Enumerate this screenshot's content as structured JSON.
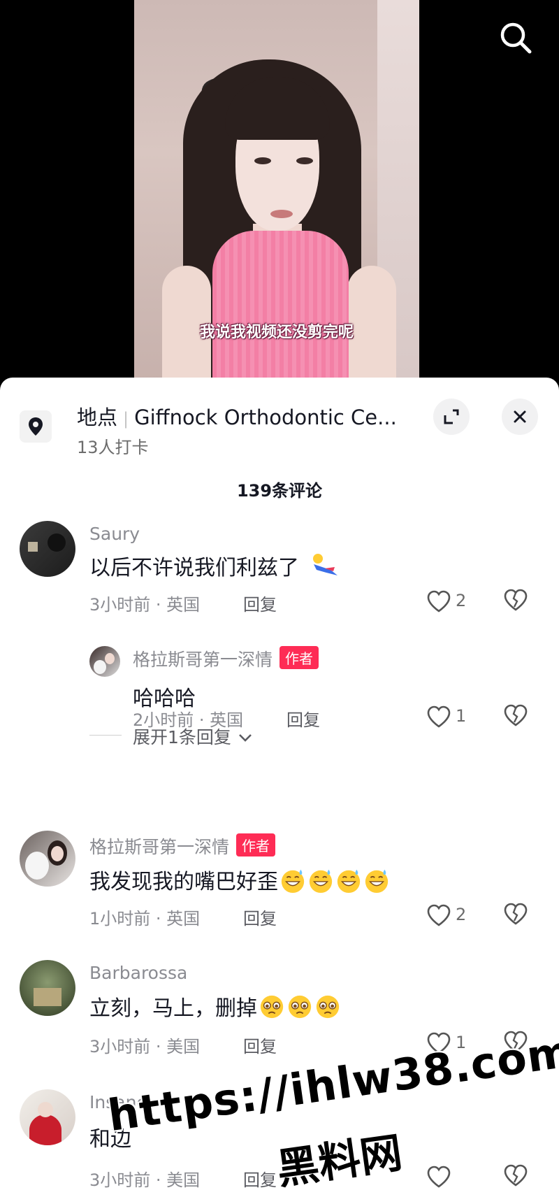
{
  "video": {
    "subtitle": "我说我视频还没剪完呢"
  },
  "location": {
    "label": "地点",
    "name": "Giffnock Orthodontic Ce...",
    "checkins": "13人打卡"
  },
  "comments_header": {
    "count_text": "139条评论"
  },
  "comments": [
    {
      "username": "Saury",
      "text": "以后不许说我们利兹了",
      "time_region": "3小时前 · 英国",
      "reply_label": "回复",
      "likes": "2"
    },
    {
      "username": "格拉斯哥第一深情",
      "badge": "作者",
      "text": "哈哈哈",
      "time_region": "2小时前 · 英国",
      "reply_label": "回复",
      "likes": "1"
    },
    {
      "username": "格拉斯哥第一深情",
      "badge": "作者",
      "text": "我发现我的嘴巴好歪",
      "time_region": "1小时前 · 英国",
      "reply_label": "回复",
      "likes": "2"
    },
    {
      "username": "Barbarossa",
      "text": "立刻，马上，删掉",
      "time_region": "3小时前 · 美国",
      "reply_label": "回复",
      "likes": "1"
    },
    {
      "username": "Insane.",
      "text": "和边",
      "time_region": "3小时前 · 美国",
      "reply_label": "回复",
      "likes": ""
    }
  ],
  "expand_replies": "展开1条回复",
  "watermark": {
    "url": "https://ihlw38.com",
    "name": "黑料网"
  },
  "colors": {
    "accent_badge": "#fe2c55",
    "text_primary": "#161823",
    "text_secondary": "#8a8b91"
  },
  "icons": [
    "search-icon",
    "location-pin-icon",
    "expand-icon",
    "close-icon",
    "heart-icon",
    "broken-heart-icon",
    "chevron-down-icon",
    "emoji-sweat-smile",
    "emoji-pleading"
  ]
}
